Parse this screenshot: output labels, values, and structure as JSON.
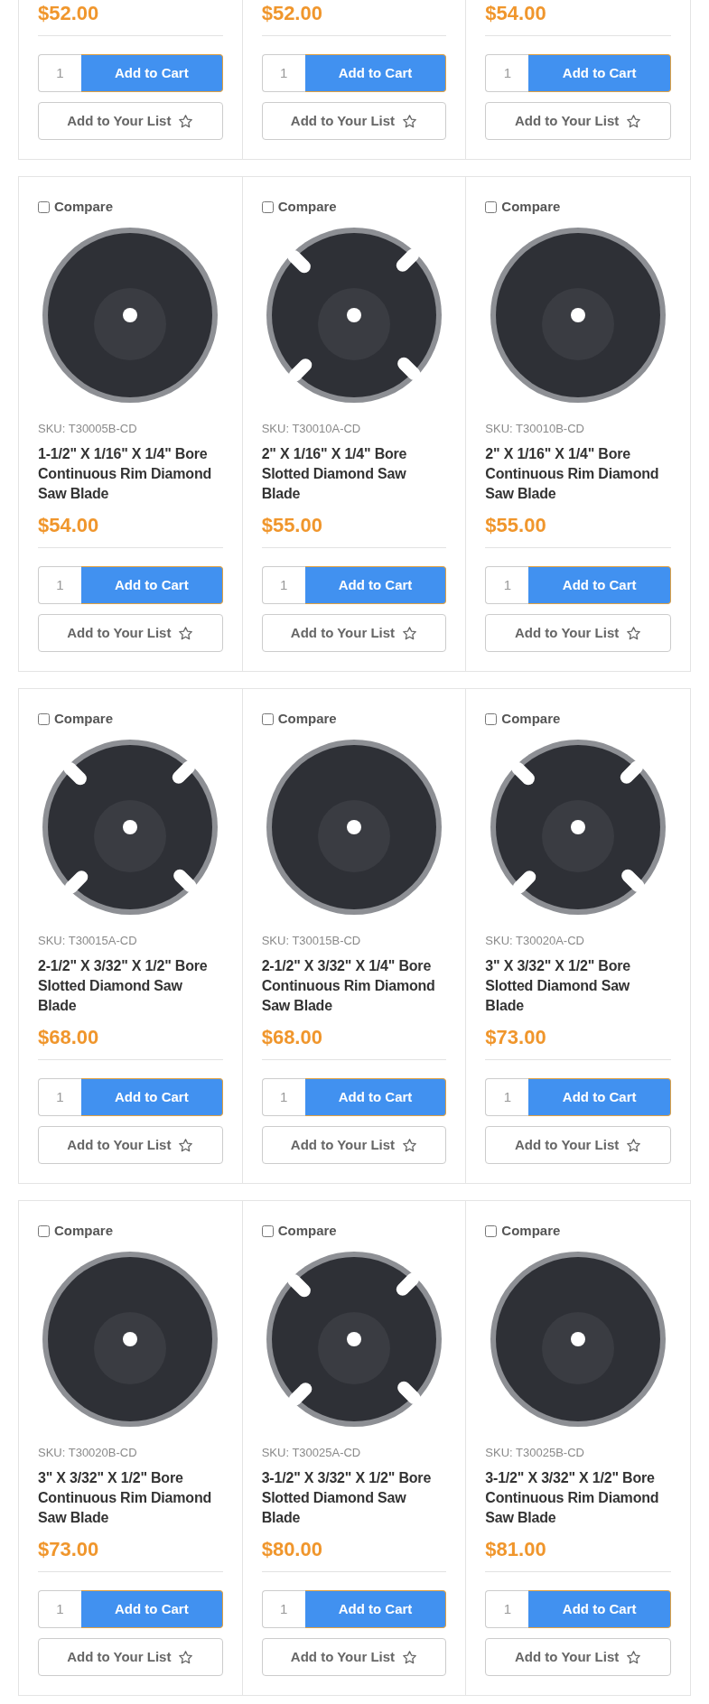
{
  "partial_row": {
    "products": [
      {
        "price": "$52.00",
        "quantity": "1",
        "cart_label": "Add to Cart",
        "list_label": "Add to Your List"
      },
      {
        "price": "$52.00",
        "quantity": "1",
        "cart_label": "Add to Cart",
        "list_label": "Add to Your List"
      },
      {
        "price": "$54.00",
        "quantity": "1",
        "cart_label": "Add to Cart",
        "list_label": "Add to Your List"
      }
    ]
  },
  "rows": [
    {
      "products": [
        {
          "compare_label": "Compare",
          "compare_checked": false,
          "kind": "continuous",
          "sku": "SKU: T30005B-CD",
          "name": "1-1/2\" X 1/16\" X 1/4\" Bore Continuous Rim Diamond Saw Blade",
          "price": "$54.00",
          "quantity": "1",
          "cart_label": "Add to Cart",
          "list_label": "Add to Your List"
        },
        {
          "compare_label": "Compare",
          "compare_checked": false,
          "kind": "slotted",
          "sku": "SKU: T30010A-CD",
          "name": "2\" X 1/16\" X 1/4\" Bore Slotted Diamond Saw Blade",
          "price": "$55.00",
          "quantity": "1",
          "cart_label": "Add to Cart",
          "list_label": "Add to Your List"
        },
        {
          "compare_label": "Compare",
          "compare_checked": false,
          "kind": "continuous",
          "sku": "SKU: T30010B-CD",
          "name": "2\" X 1/16\" X 1/4\" Bore Continuous Rim Diamond Saw Blade",
          "price": "$55.00",
          "quantity": "1",
          "cart_label": "Add to Cart",
          "list_label": "Add to Your List"
        }
      ]
    },
    {
      "products": [
        {
          "compare_label": "Compare",
          "compare_checked": false,
          "kind": "slotted",
          "sku": "SKU: T30015A-CD",
          "name": "2-1/2\" X 3/32\" X 1/2\" Bore Slotted Diamond Saw Blade",
          "price": "$68.00",
          "quantity": "1",
          "cart_label": "Add to Cart",
          "list_label": "Add to Your List"
        },
        {
          "compare_label": "Compare",
          "compare_checked": false,
          "kind": "continuous",
          "sku": "SKU: T30015B-CD",
          "name": "2-1/2\" X 3/32\" X 1/4\" Bore Continuous Rim Diamond Saw Blade",
          "price": "$68.00",
          "quantity": "1",
          "cart_label": "Add to Cart",
          "list_label": "Add to Your List"
        },
        {
          "compare_label": "Compare",
          "compare_checked": false,
          "kind": "slotted",
          "sku": "SKU: T30020A-CD",
          "name": "3\" X 3/32\" X 1/2\" Bore Slotted Diamond Saw Blade",
          "price": "$73.00",
          "quantity": "1",
          "cart_label": "Add to Cart",
          "list_label": "Add to Your List"
        }
      ]
    },
    {
      "products": [
        {
          "compare_label": "Compare",
          "compare_checked": false,
          "kind": "continuous",
          "sku": "SKU: T30020B-CD",
          "name": "3\" X 3/32\" X 1/2\" Bore Continuous Rim Diamond Saw Blade",
          "price": "$73.00",
          "quantity": "1",
          "cart_label": "Add to Cart",
          "list_label": "Add to Your List"
        },
        {
          "compare_label": "Compare",
          "compare_checked": false,
          "kind": "slotted",
          "sku": "SKU: T30025A-CD",
          "name": "3-1/2\" X 3/32\" X 1/2\" Bore Slotted Diamond Saw Blade",
          "price": "$80.00",
          "quantity": "1",
          "cart_label": "Add to Cart",
          "list_label": "Add to Your List"
        },
        {
          "compare_label": "Compare",
          "compare_checked": false,
          "kind": "continuous",
          "sku": "SKU: T30025B-CD",
          "name": "3-1/2\" X 3/32\" X 1/2\" Bore Continuous Rim Diamond Saw Blade",
          "price": "$81.00",
          "quantity": "1",
          "cart_label": "Add to Cart",
          "list_label": "Add to Your List"
        }
      ]
    }
  ]
}
